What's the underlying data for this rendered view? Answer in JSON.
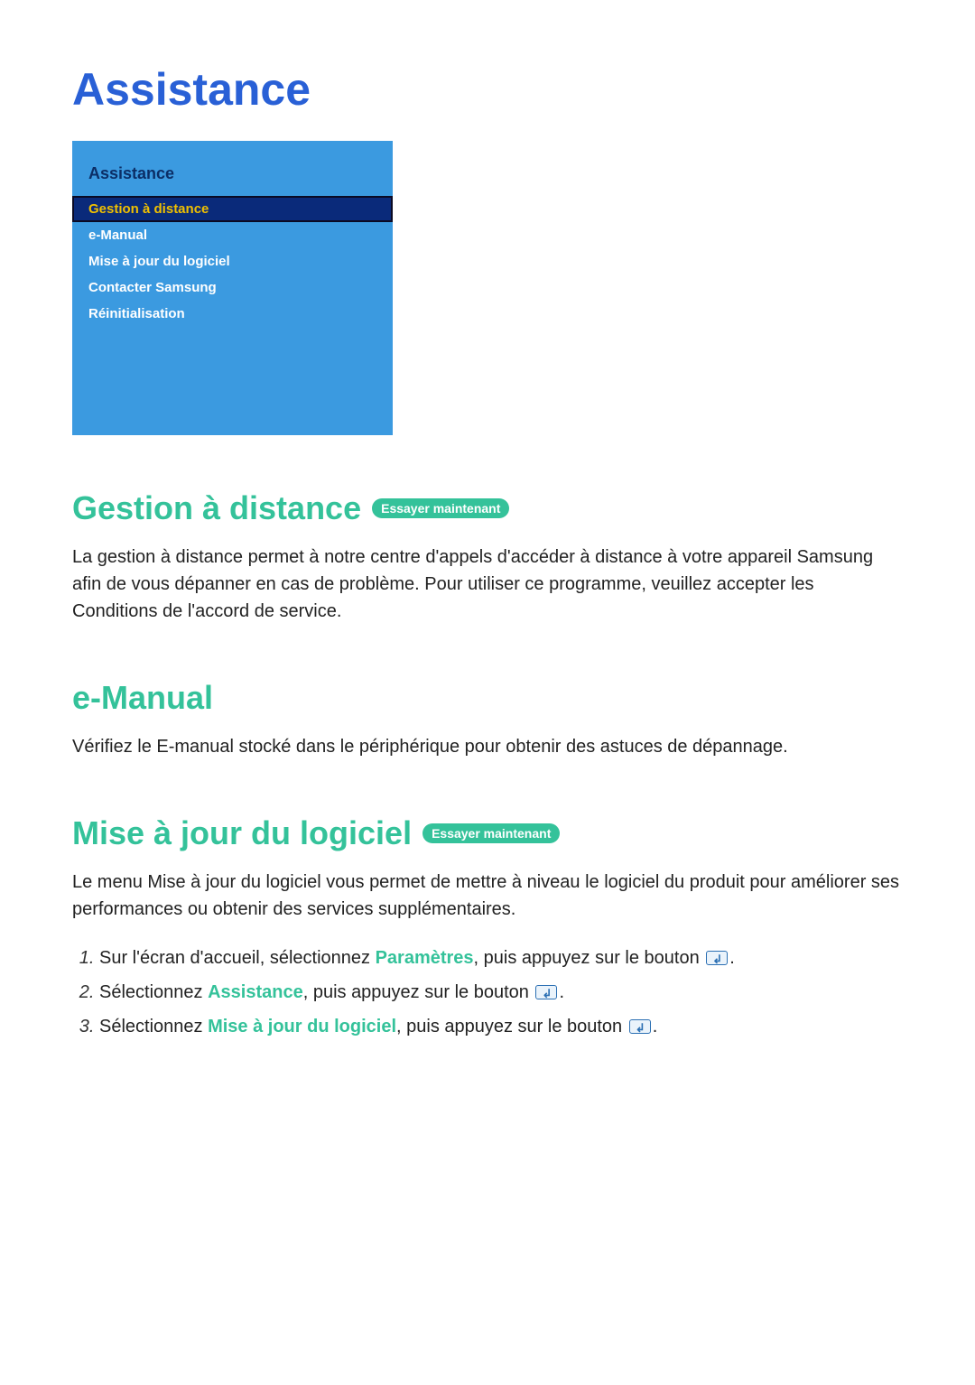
{
  "page": {
    "title": "Assistance"
  },
  "menu": {
    "header": "Assistance",
    "items": [
      "Gestion à distance",
      "e-Manual",
      "Mise à jour du logiciel",
      "Contacter Samsung",
      "Réinitialisation"
    ],
    "selected_index": 0
  },
  "badges": {
    "try_now": "Essayer maintenant"
  },
  "sections": {
    "gestion": {
      "title": "Gestion à distance",
      "body": "La gestion à distance permet à notre centre d'appels d'accéder à distance à votre appareil Samsung afin de vous dépanner en cas de problème. Pour utiliser ce programme, veuillez accepter les Conditions de l'accord de service."
    },
    "emanual": {
      "title": "e-Manual",
      "body": "Vérifiez le E-manual stocké dans le périphérique pour obtenir des astuces de dépannage."
    },
    "maj": {
      "title": "Mise à jour du logiciel",
      "body": "Le menu Mise à jour du logiciel vous permet de mettre à niveau le logiciel du produit pour améliorer ses performances ou obtenir des services supplémentaires.",
      "steps": {
        "s1a": "Sur l'écran d'accueil, sélectionnez ",
        "s1k": "Paramètres",
        "s1b": ", puis appuyez sur le bouton ",
        "s2a": "Sélectionnez ",
        "s2k": "Assistance",
        "s2b": ", puis appuyez sur le bouton ",
        "s3a": "Sélectionnez ",
        "s3k": "Mise à jour du logiciel",
        "s3b": ", puis appuyez sur le bouton ",
        "period": "."
      }
    }
  }
}
